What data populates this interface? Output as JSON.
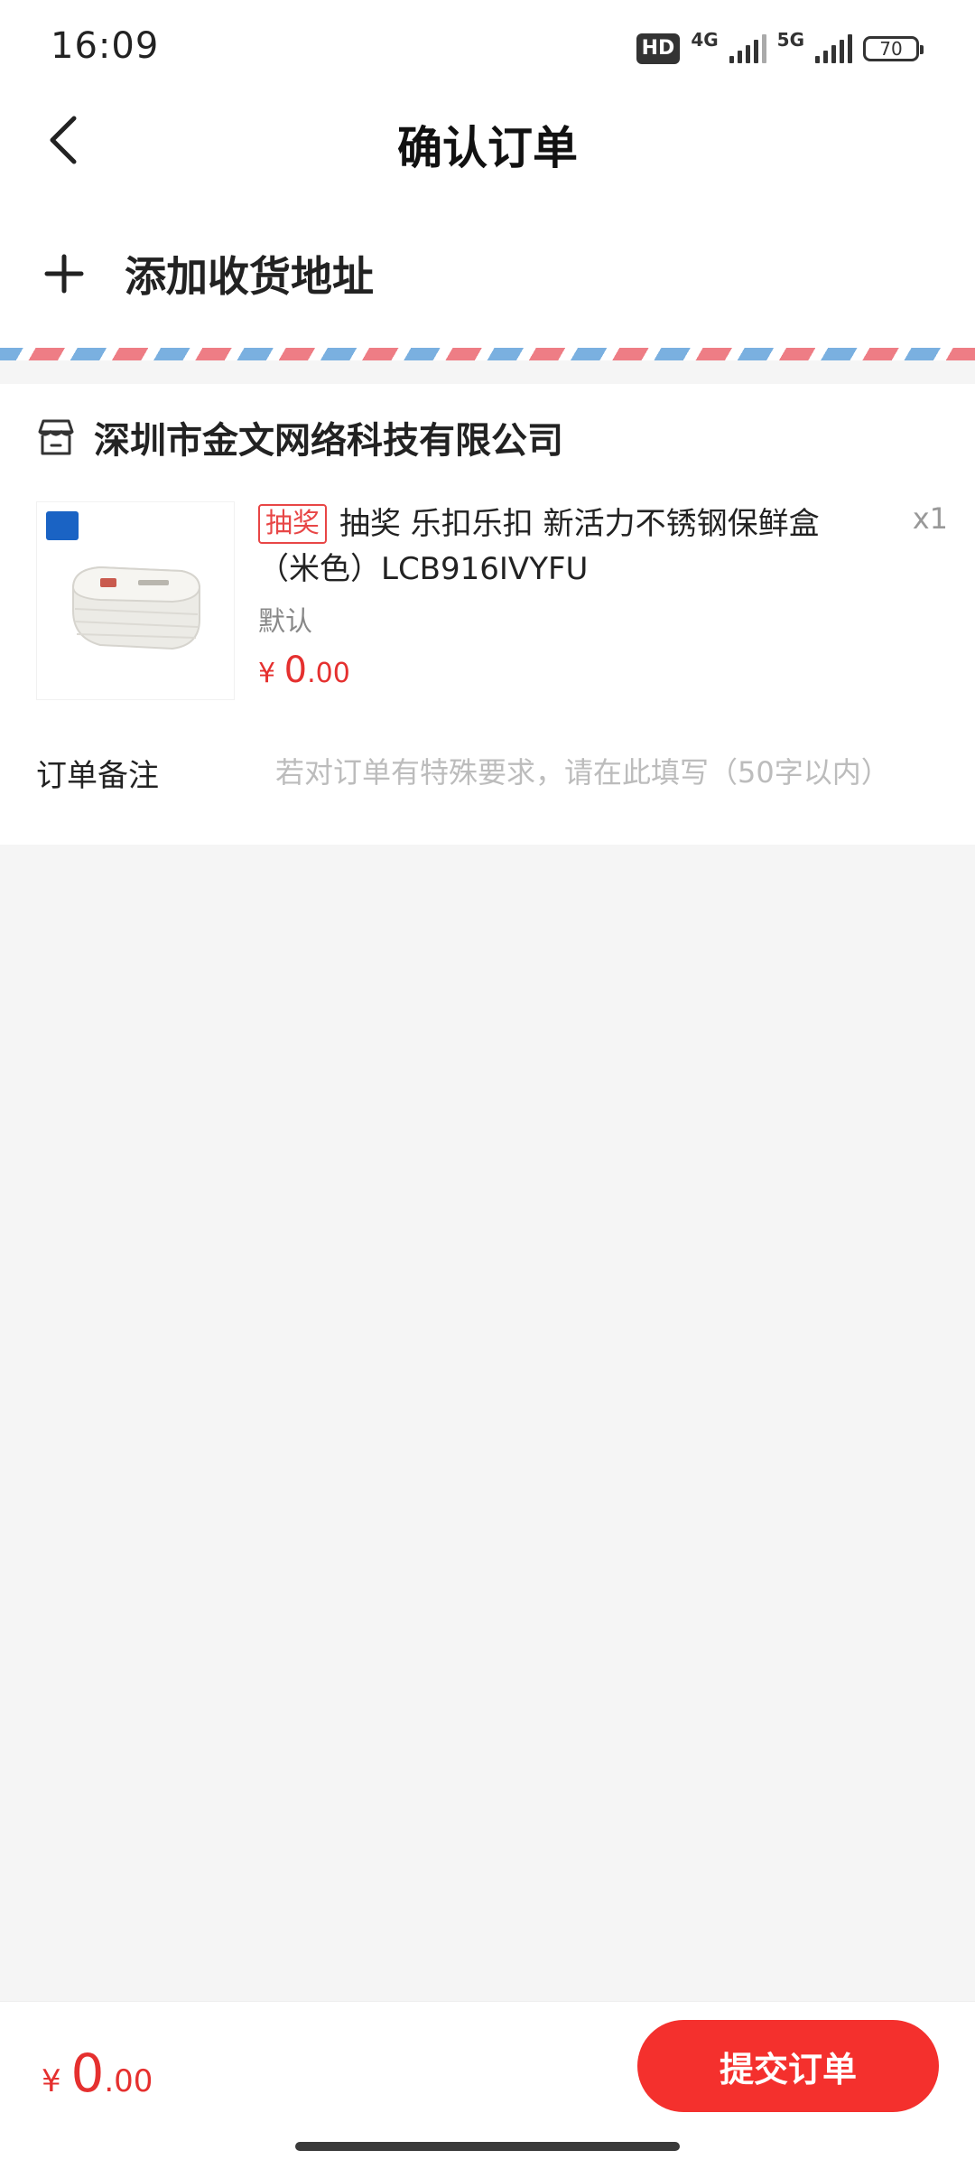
{
  "status_bar": {
    "time": "16:09",
    "hd_label": "HD",
    "network_1": "4G",
    "network_2": "5G",
    "battery": "70"
  },
  "nav": {
    "title": "确认订单",
    "back_icon": "chevron-left-icon"
  },
  "address": {
    "add_label": "添加收货地址",
    "icon": "plus-icon"
  },
  "shop": {
    "name": "深圳市金文网络科技有限公司",
    "icon": "store-icon"
  },
  "product": {
    "tag": "抽奖",
    "title": "抽奖 乐扣乐扣 新活力不锈钢保鲜盒（米色）LCB916IVYFU",
    "spec": "默认",
    "price_symbol": "¥",
    "price_int": "0",
    "price_dec": ".00",
    "quantity": "x1"
  },
  "remark": {
    "label": "订单备注",
    "placeholder": "若对订单有特殊要求，请在此填写（50字以内）",
    "value": ""
  },
  "footer": {
    "price_symbol": "¥",
    "price_int": "0",
    "price_dec": ".00",
    "submit_label": "提交订单"
  },
  "colors": {
    "accent": "#f4302d",
    "price": "#e5302f",
    "airmail_red": "#ee7d85",
    "airmail_blue": "#7ab0e0"
  }
}
